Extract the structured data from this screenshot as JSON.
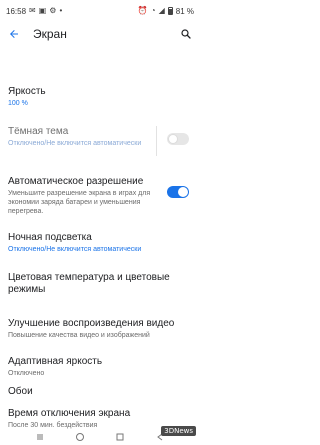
{
  "status_bar": {
    "time": "16:58",
    "battery_percent": "81 %",
    "left_icons": [
      "mail-icon",
      "photo-icon",
      "settings-icon",
      "dot-icon"
    ],
    "right_icons": [
      "alarm-icon",
      "wifi-icon",
      "signal-icon",
      "battery-icon"
    ]
  },
  "app_bar": {
    "title": "Экран"
  },
  "settings": {
    "brightness": {
      "title": "Яркость",
      "value": "100 %"
    },
    "dark_theme": {
      "title": "Тёмная тема",
      "subtitle": "Отключено/Не включится автоматически",
      "enabled": false
    },
    "auto_resolution": {
      "title": "Автоматическое разрешение",
      "subtitle": "Уменьшите разрешение экрана в играх для экономии заряда батареи и уменьшения перегрева.",
      "enabled": true
    },
    "night_light": {
      "title": "Ночная подсветка",
      "subtitle": "Отключено/Не включится автоматически"
    },
    "color_temp": {
      "title": "Цветовая температура и цветовые режимы"
    },
    "video_enhance": {
      "title": "Улучшение воспроизведения видео",
      "subtitle": "Повышение качества видео и изображений"
    },
    "adaptive_brightness": {
      "title": "Адаптивная яркость",
      "subtitle": "Отключено"
    },
    "wallpaper": {
      "title": "Обои"
    },
    "screen_timeout": {
      "title": "Время отключения экрана",
      "subtitle": "После 30 мин. бездействия"
    }
  },
  "watermark": "3DNews",
  "colors": {
    "accent": "#1a73e8",
    "text_primary": "#202124",
    "text_secondary": "#6b6b6b"
  }
}
